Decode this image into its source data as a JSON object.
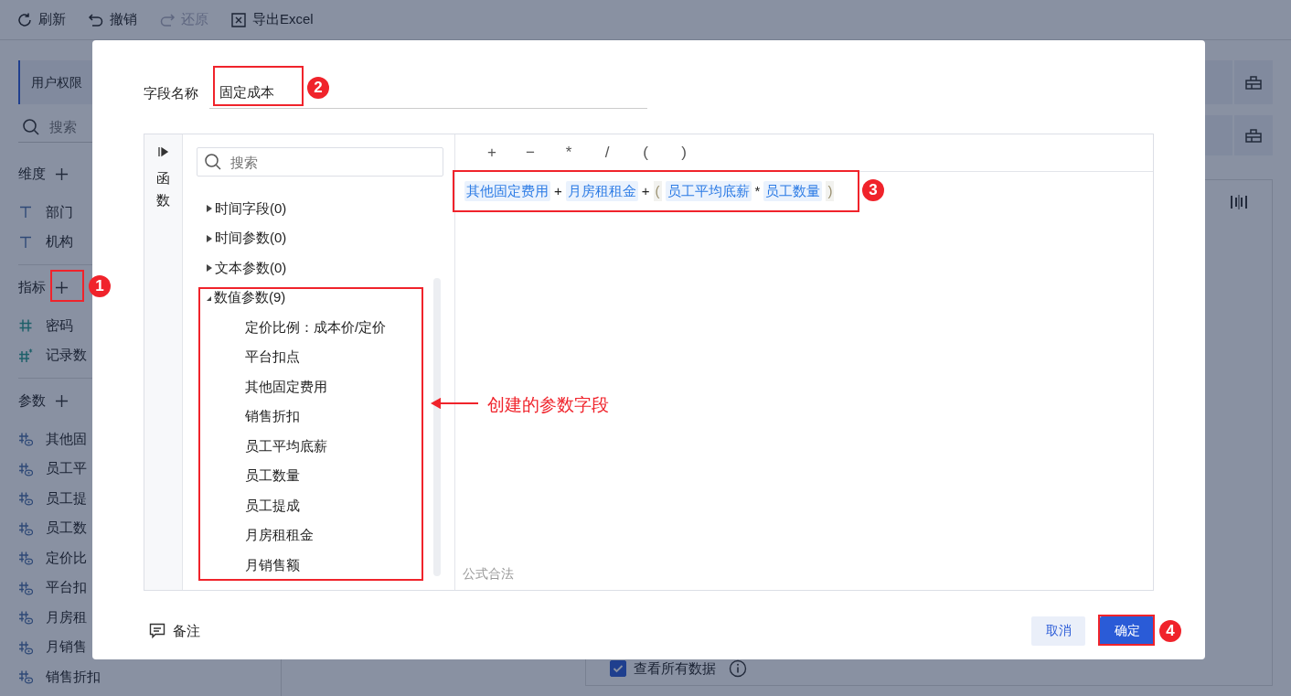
{
  "toolbar": [
    {
      "label": "刷新",
      "kind": "refresh",
      "disabled": false
    },
    {
      "label": "撤销",
      "kind": "undo",
      "disabled": false
    },
    {
      "label": "还原",
      "kind": "redo",
      "disabled": true
    },
    {
      "label": "导出Excel",
      "kind": "excel",
      "disabled": false
    }
  ],
  "left_panel": {
    "table_tab": "用户权限",
    "search_placeholder": "搜索",
    "sections": [
      {
        "title": "维度",
        "items": [
          {
            "label": "部门",
            "kind": "text"
          },
          {
            "label": "机构",
            "kind": "text"
          }
        ]
      },
      {
        "title": "指标",
        "items": [
          {
            "label": "密码",
            "kind": "number"
          },
          {
            "label": "记录数",
            "kind": "count"
          }
        ]
      },
      {
        "title": "参数",
        "items": [
          {
            "label": "其他固",
            "kind": "param"
          },
          {
            "label": "员工平",
            "kind": "param"
          },
          {
            "label": "员工提",
            "kind": "param"
          },
          {
            "label": "员工数",
            "kind": "param"
          },
          {
            "label": "定价比",
            "kind": "param"
          },
          {
            "label": "平台扣",
            "kind": "param"
          },
          {
            "label": "月房租",
            "kind": "param"
          },
          {
            "label": "月销售",
            "kind": "param"
          },
          {
            "label": "销售折扣",
            "kind": "param"
          }
        ]
      }
    ]
  },
  "main": {
    "view_all_data": {
      "label": "查看所有数据",
      "checked": true
    }
  },
  "dialog": {
    "field_name_label": "字段名称",
    "field_name": "固定成本",
    "functions_tab": "函数",
    "search_placeholder": "搜索",
    "tree": [
      {
        "label": "时间字段(0)",
        "expanded": false
      },
      {
        "label": "时间参数(0)",
        "expanded": false
      },
      {
        "label": "文本参数(0)",
        "expanded": false
      },
      {
        "label": "数值参数(9)",
        "expanded": true,
        "children": [
          {
            "label": "定价比例：成本价/定价"
          },
          {
            "label": "平台扣点"
          },
          {
            "label": "其他固定费用"
          },
          {
            "label": "销售折扣"
          },
          {
            "label": "员工平均底薪"
          },
          {
            "label": "员工数量"
          },
          {
            "label": "员工提成"
          },
          {
            "label": "月房租租金"
          },
          {
            "label": "月销售额"
          }
        ]
      }
    ],
    "operators": [
      "+",
      "−",
      "*",
      "/",
      "(",
      ")"
    ],
    "formula": [
      {
        "text": "其他固定费用",
        "kind": "field"
      },
      {
        "text": "+",
        "kind": "operator"
      },
      {
        "text": "月房租租金",
        "kind": "field"
      },
      {
        "text": "+",
        "kind": "operator"
      },
      {
        "text": "(",
        "kind": "paren"
      },
      {
        "text": "员工平均底薪",
        "kind": "field"
      },
      {
        "text": "*",
        "kind": "operator"
      },
      {
        "text": "员工数量",
        "kind": "field"
      },
      {
        "text": ")",
        "kind": "paren"
      }
    ],
    "status": "公式合法",
    "note_button": "备注",
    "buttons": [
      {
        "label": "取消",
        "kind": "secondary"
      },
      {
        "label": "确定",
        "kind": "primary"
      }
    ]
  },
  "annotations": {
    "markers": [
      "1",
      "2",
      "3",
      "4"
    ],
    "callout": "创建的参数字段"
  }
}
